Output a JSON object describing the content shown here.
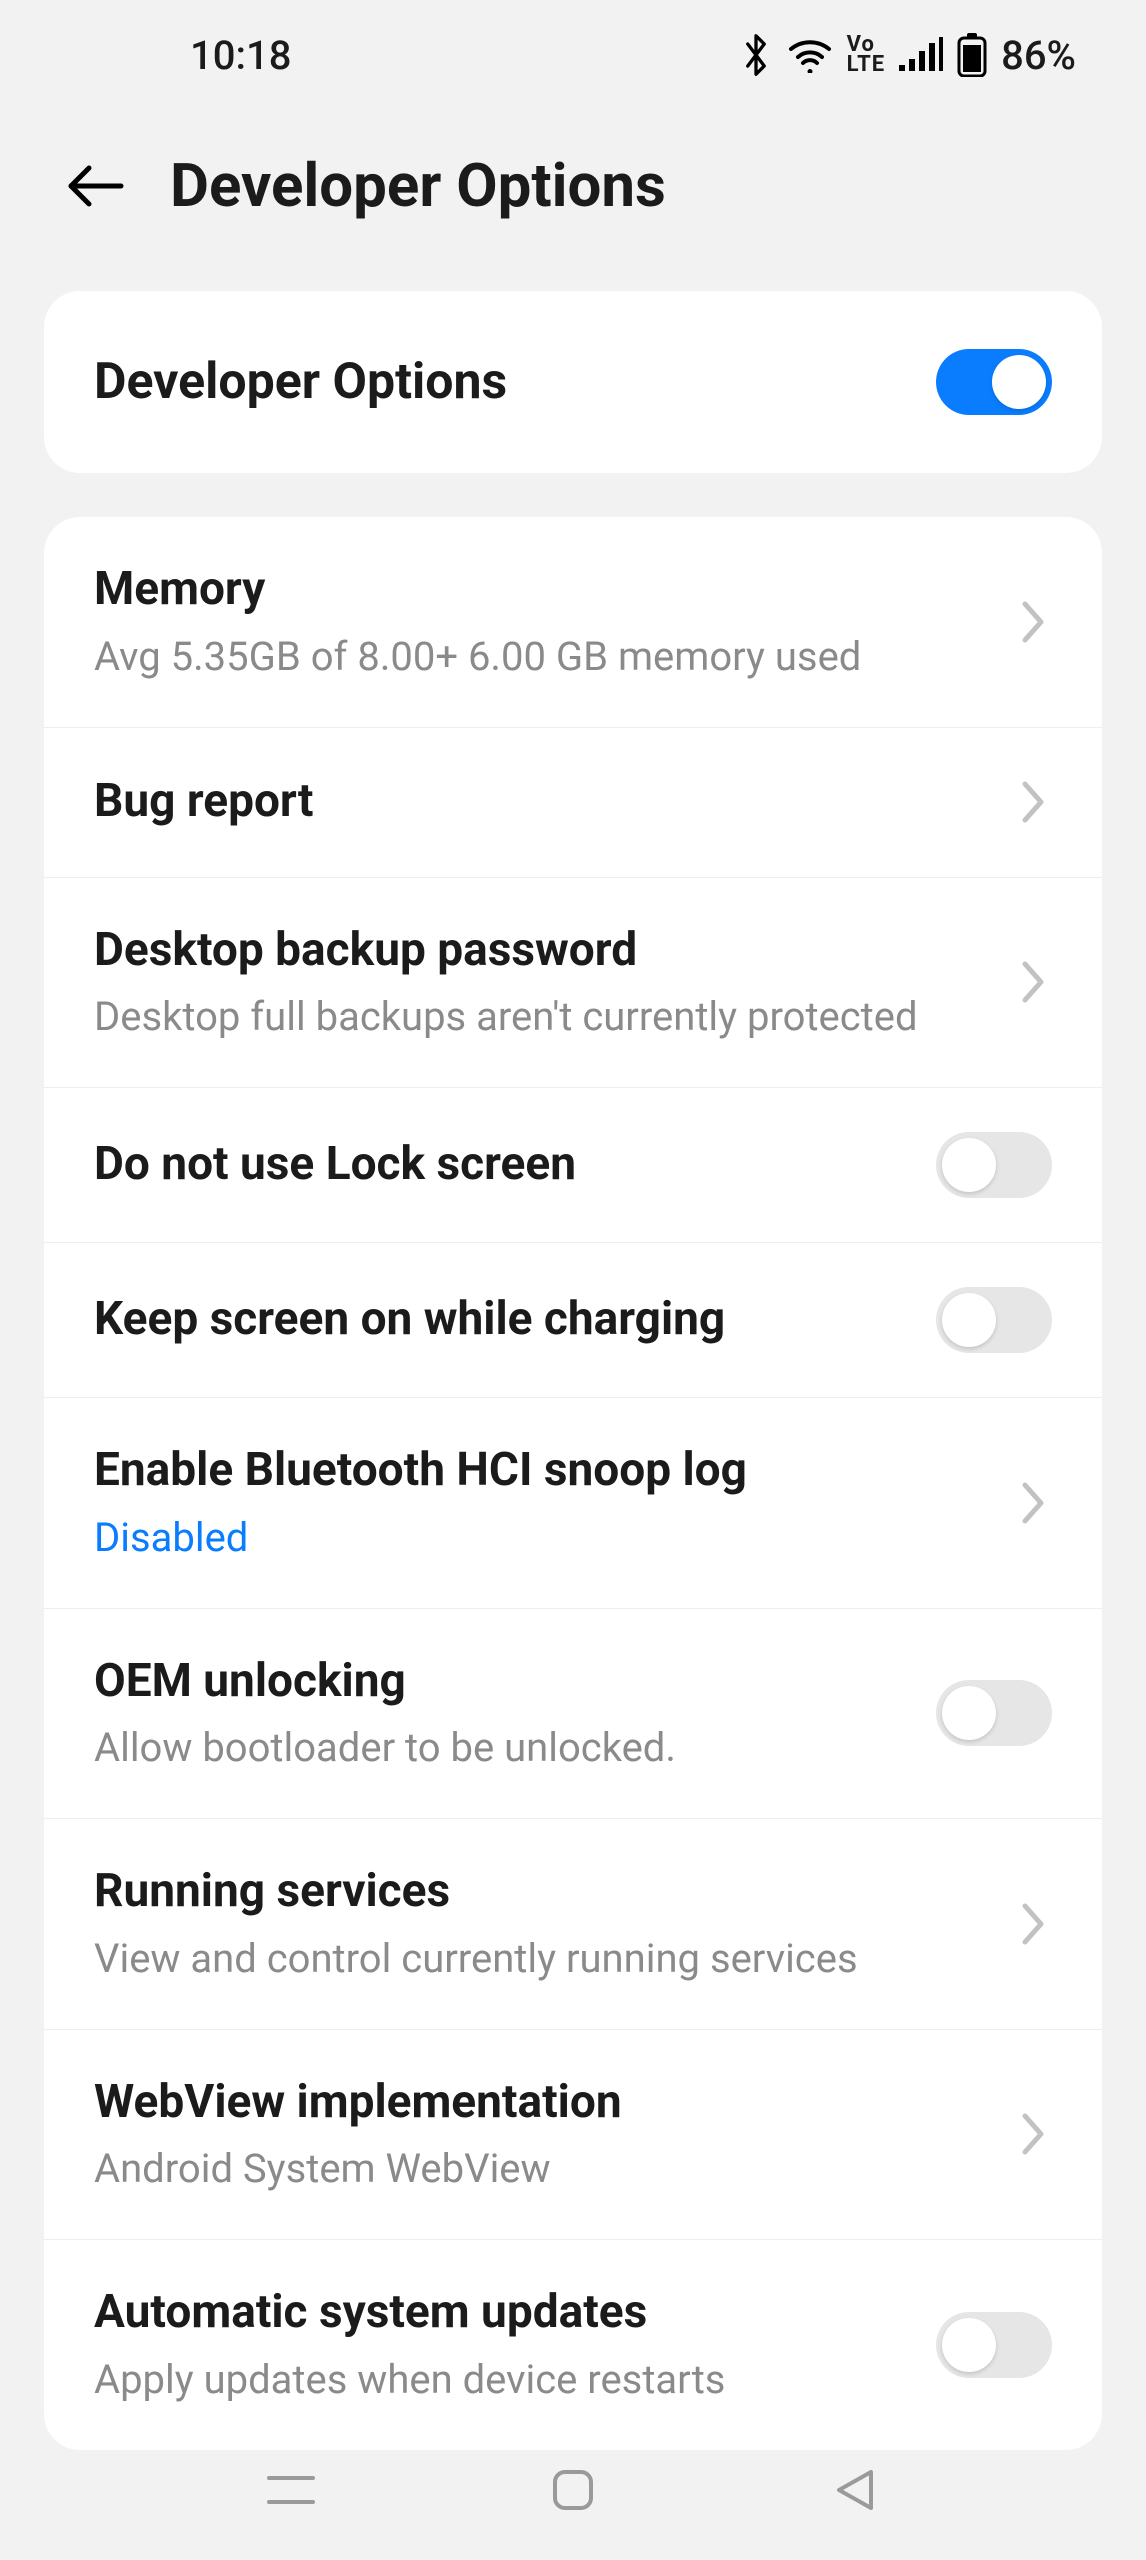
{
  "status": {
    "time": "10:18",
    "battery_pct": "86%"
  },
  "header": {
    "title": "Developer Options"
  },
  "master": {
    "label": "Developer Options",
    "enabled": true
  },
  "items": [
    {
      "title": "Memory",
      "subtitle": "Avg 5.35GB of 8.00+ 6.00 GB memory used",
      "type": "link"
    },
    {
      "title": "Bug report",
      "subtitle": "",
      "type": "link"
    },
    {
      "title": "Desktop backup password",
      "subtitle": "Desktop full backups aren't currently protected",
      "type": "link"
    },
    {
      "title": "Do not use Lock screen",
      "subtitle": "",
      "type": "toggle",
      "value": false
    },
    {
      "title": "Keep screen on while charging",
      "subtitle": "",
      "type": "toggle",
      "value": false
    },
    {
      "title": "Enable Bluetooth HCI snoop log",
      "subtitle": "Disabled",
      "subtitle_style": "blue",
      "type": "link"
    },
    {
      "title": "OEM unlocking",
      "subtitle": "Allow bootloader to be unlocked.",
      "type": "toggle",
      "value": false
    },
    {
      "title": "Running services",
      "subtitle": "View and control currently running services",
      "type": "link"
    },
    {
      "title": "WebView implementation",
      "subtitle": "Android System WebView",
      "type": "link"
    },
    {
      "title": "Automatic system updates",
      "subtitle": "Apply updates when device restarts",
      "type": "toggle",
      "value": false
    }
  ]
}
